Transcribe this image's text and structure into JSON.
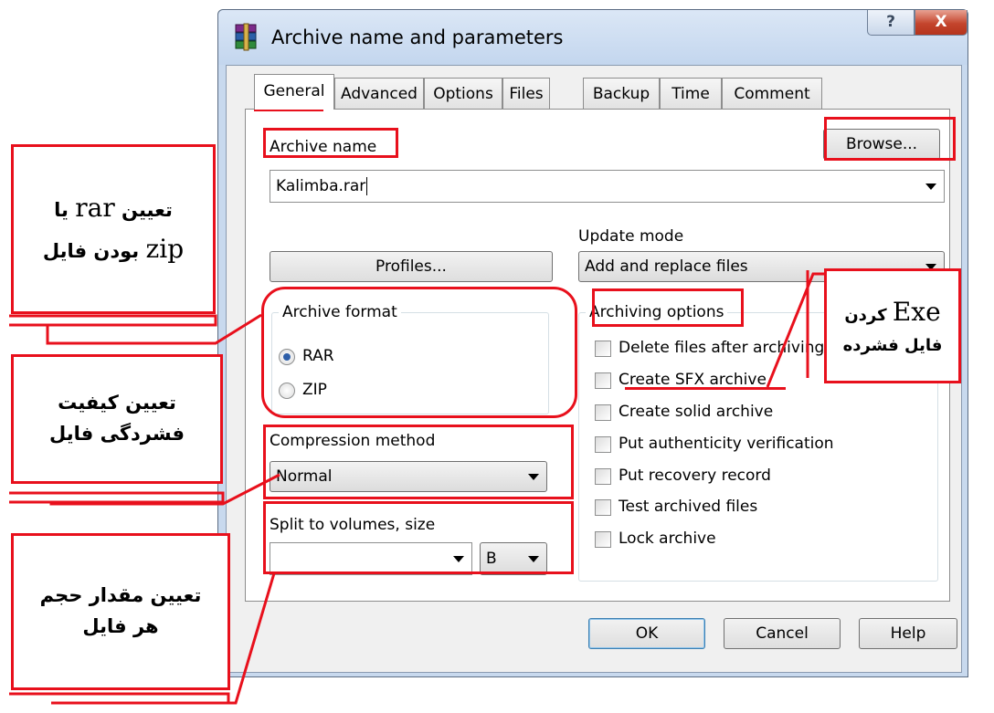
{
  "window": {
    "title": "Archive name and parameters",
    "help_label": "?",
    "close_label": "X"
  },
  "tabs": [
    {
      "label": "General",
      "active": true
    },
    {
      "label": "Advanced",
      "active": false
    },
    {
      "label": "Options",
      "active": false
    },
    {
      "label": "Files",
      "active": false
    },
    {
      "label": "Backup",
      "active": false
    },
    {
      "label": "Time",
      "active": false
    },
    {
      "label": "Comment",
      "active": false
    }
  ],
  "general": {
    "archive_name_label": "Archive name",
    "archive_name_value": "Kalimba.rar",
    "browse_label": "Browse...",
    "update_mode_label": "Update mode",
    "update_mode_value": "Add and replace files",
    "profiles_label": "Profiles...",
    "archive_format": {
      "title": "Archive format",
      "options": [
        {
          "label": "RAR",
          "checked": true
        },
        {
          "label": "ZIP",
          "checked": false
        }
      ]
    },
    "compression_method_label": "Compression method",
    "compression_method_value": "Normal",
    "split_label": "Split to volumes, size",
    "split_value": "",
    "split_unit": "B",
    "archiving_options": {
      "title": "Archiving options",
      "items": [
        {
          "label": "Delete files after archiving",
          "checked": false
        },
        {
          "label": "Create SFX archive",
          "checked": false
        },
        {
          "label": "Create solid archive",
          "checked": false
        },
        {
          "label": "Put authenticity verification",
          "checked": false
        },
        {
          "label": "Put recovery record",
          "checked": false
        },
        {
          "label": "Test archived files",
          "checked": false
        },
        {
          "label": "Lock archive",
          "checked": false
        }
      ]
    }
  },
  "footer": {
    "ok_label": "OK",
    "cancel_label": "Cancel",
    "help_label": "Help"
  },
  "annotations": {
    "rar_zip": {
      "prefix": "تعیین",
      "rar": "rar",
      "ya": "یا",
      "zip": "zip",
      "suffix": "بودن فایل"
    },
    "quality": {
      "line1": "تعیین کیفیت",
      "line2": "فشردگی فایل"
    },
    "size": {
      "line1": "تعیین مقدار حجم",
      "line2": "هر فایل"
    },
    "exe": {
      "exe": "Exe",
      "kardan": "کردن",
      "line2": "فایل فشرده"
    }
  },
  "colors": {
    "annotation_red": "#e8101c",
    "title_bar": "#c8d9ee",
    "close_button": "#c4452d",
    "radio_dot": "#2d5ea8"
  }
}
